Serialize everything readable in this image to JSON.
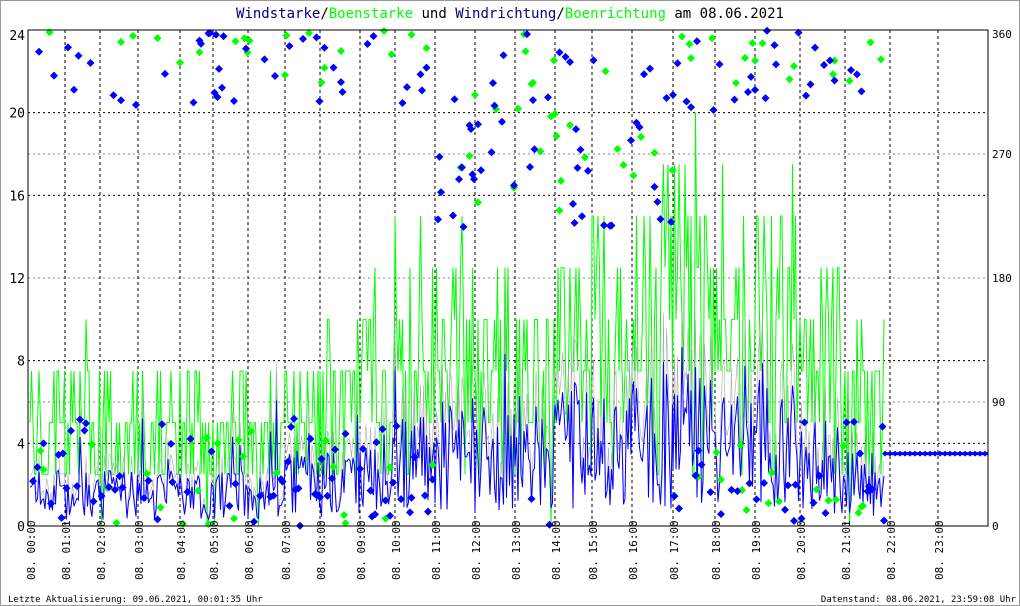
{
  "chart_data": {
    "type": "line+scatter",
    "title_parts": [
      {
        "text": "Windstarke",
        "color": "#000080"
      },
      {
        "text": "/",
        "color": "#000000"
      },
      {
        "text": "Boenstarke",
        "color": "#00ff00"
      },
      {
        "text": " und ",
        "color": "#000000"
      },
      {
        "text": "Windrichtung",
        "color": "#000080"
      },
      {
        "text": "/",
        "color": "#000000"
      },
      {
        "text": "Boenrichtung",
        "color": "#00ff00"
      },
      {
        "text": " am 08.06.2021",
        "color": "#000000"
      }
    ],
    "y_left": {
      "range": [
        0,
        24
      ],
      "ticks": [
        "0",
        "4",
        "8",
        "12",
        "16",
        "20",
        "24"
      ]
    },
    "y_right": {
      "range": [
        0,
        360
      ],
      "ticks": [
        "0",
        "90",
        "180",
        "270",
        "360"
      ]
    },
    "x_ticks": [
      "08. 00:00",
      "08. 01:01",
      "08. 02:00",
      "08. 03:00",
      "08. 04:00",
      "08. 05:00",
      "08. 06:00",
      "08. 07:00",
      "08. 08:00",
      "08. 09:00",
      "08. 10:00",
      "08. 11:00",
      "08. 12:00",
      "08. 13:00",
      "08. 14:00",
      "08. 15:00",
      "08. 16:00",
      "08. 17:00",
      "08. 18:00",
      "08. 19:00",
      "08. 20:00",
      "08. 21:01",
      "08. 22:00",
      "08. 23:00"
    ],
    "grid": true,
    "series": [
      {
        "name": "Windstarke",
        "color": "#0000ff",
        "axis": "left",
        "hourly_mean": [
          1.5,
          1.5,
          1.5,
          1.5,
          1.5,
          1.5,
          1.5,
          2,
          2,
          2.5,
          3,
          3.5,
          3,
          3.5,
          4,
          3.5,
          4,
          4.5,
          4,
          4.5,
          3,
          2
        ],
        "after_21_45_constant": 3.5
      },
      {
        "name": "Boenstarke",
        "color": "#00ff00",
        "axis": "left",
        "hourly_max": [
          7.5,
          10,
          7.5,
          7.5,
          7.5,
          7.5,
          7.5,
          7.5,
          10,
          12,
          15.5,
          15.5,
          12,
          10,
          12.5,
          15,
          19,
          19.5,
          17,
          18,
          15,
          10
        ]
      },
      {
        "name": "Windrichtung",
        "color": "#0000ff",
        "axis": "right",
        "hourly_typical_deg": [
          350,
          350,
          350,
          350,
          350,
          350,
          350,
          350,
          350,
          345,
          350,
          260,
          260,
          300,
          255,
          255,
          255,
          340,
          345,
          350,
          350,
          350
        ]
      },
      {
        "name": "Boenrichtung",
        "color": "#00ff00",
        "axis": "right",
        "hourly_typical_deg": [
          350,
          350,
          350,
          350,
          350,
          350,
          350,
          350,
          350,
          345,
          350,
          260,
          260,
          300,
          255,
          255,
          255,
          345,
          350,
          350,
          350,
          350
        ]
      }
    ]
  },
  "footer": {
    "last_update": "Letzte Aktualisierung: 09.06.2021, 00:01:35 Uhr",
    "data_state": "Datenstand: 08.06.2021, 23:59:08 Uhr"
  }
}
